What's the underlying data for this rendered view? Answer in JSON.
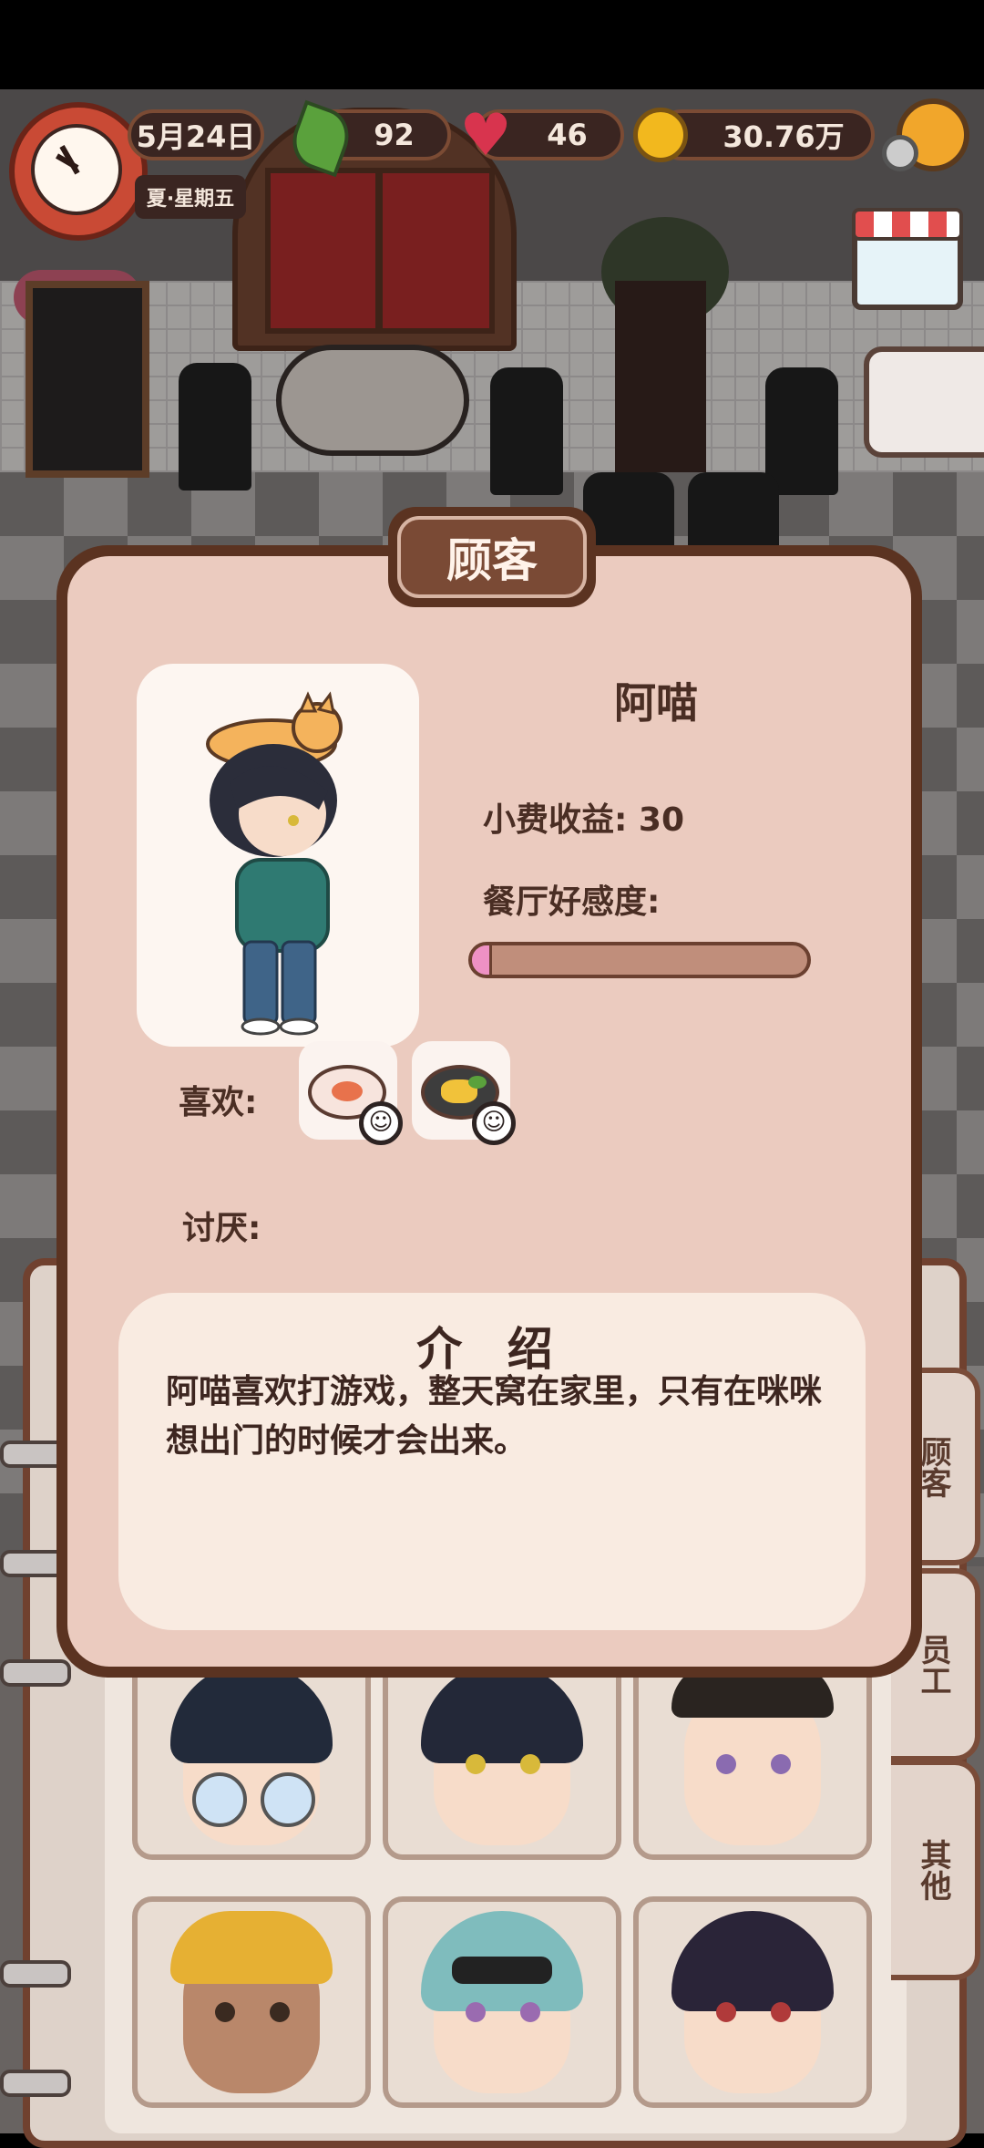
{
  "hud": {
    "date": "5月24日",
    "season_day": "夏·星期五",
    "leaves": "92",
    "hearts": "46",
    "coins": "30.76万"
  },
  "dialog": {
    "title": "顾客",
    "customer_name": "阿喵",
    "tip_income": "小费收益: 30",
    "favorability_label": "餐厅好感度:",
    "favorability_fraction": 0.06,
    "likes_label": "喜欢:",
    "dislikes_label": "讨厌:",
    "liked_foods": [
      "shrimp-plate-icon",
      "fried-dish-plate-icon"
    ],
    "intro_title": "介 绍",
    "intro_text": "阿喵喜欢打游戏，整天窝在家里，只有在咪咪想出门的时候才会出来。"
  },
  "side_tabs": [
    {
      "label": "顾客"
    },
    {
      "label": "员工"
    },
    {
      "label": "其他"
    }
  ],
  "colors": {
    "dialog_border": "#5b3321",
    "dialog_bg": "#ebcbbf",
    "favor_fill": "#ee91c4",
    "favor_track": "#c08e7b"
  }
}
